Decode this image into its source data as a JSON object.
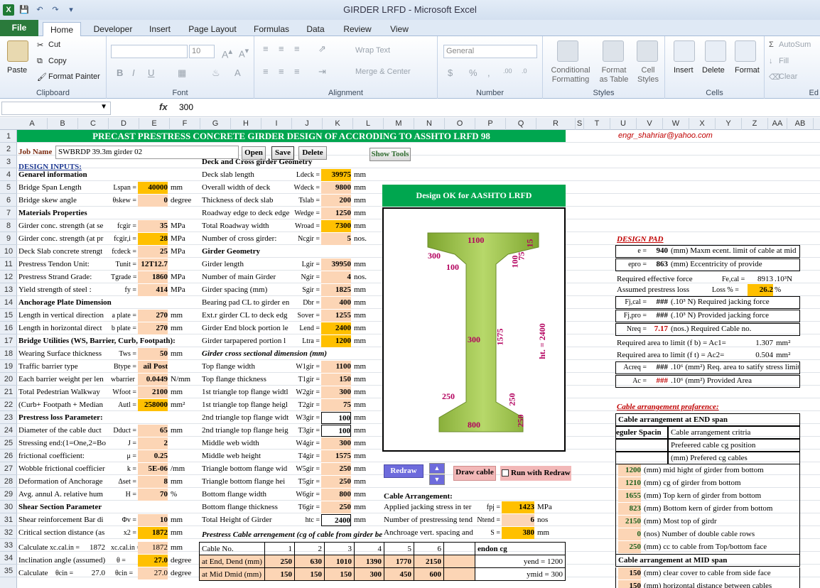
{
  "window": {
    "title": "GIRDER LRFD  -  Microsoft Excel"
  },
  "tabs": [
    "File",
    "Home",
    "Developer",
    "Insert",
    "Page Layout",
    "Formulas",
    "Data",
    "Review",
    "View"
  ],
  "ribbon": {
    "clipboard": {
      "paste": "Paste",
      "cut": "Cut",
      "copy": "Copy",
      "format_painter": "Format Painter",
      "label": "Clipboard"
    },
    "font": {
      "size": "10",
      "label": "Font",
      "bold": "B",
      "italic": "I",
      "underline": "U"
    },
    "alignment": {
      "wrap": "Wrap Text",
      "merge": "Merge & Center",
      "label": "Alignment"
    },
    "number": {
      "format": "General",
      "label": "Number"
    },
    "styles": {
      "conditional": "Conditional Formatting",
      "format_table": "Format as Table",
      "cell_styles": "Cell Styles",
      "label": "Styles"
    },
    "cells": {
      "insert": "Insert",
      "delete": "Delete",
      "format": "Format",
      "label": "Cells"
    },
    "editing": {
      "autosum": "AutoSum",
      "fill": "Fill",
      "clear": "Clear",
      "label": "Ed"
    }
  },
  "formula_bar": {
    "fx": "fx",
    "value": "300"
  },
  "columns": [
    "A",
    "B",
    "C",
    "D",
    "E",
    "F",
    "G",
    "H",
    "I",
    "J",
    "K",
    "L",
    "M",
    "N",
    "O",
    "P",
    "Q",
    "R",
    "S",
    "T",
    "U",
    "V",
    "W",
    "X",
    "Y",
    "Z",
    "AA",
    "AB"
  ],
  "rows": [
    "1",
    "2",
    "3",
    "4",
    "5",
    "6",
    "7",
    "8",
    "9",
    "10",
    "11",
    "12",
    "13",
    "14",
    "15",
    "16",
    "17",
    "18",
    "19",
    "20",
    "21",
    "22",
    "23",
    "24",
    "25",
    "26",
    "27",
    "28",
    "29",
    "30",
    "31",
    "32",
    "33",
    "34",
    "35"
  ],
  "sheet": {
    "banner": "PRECAST PRESTRESS CONCRETE GIRDER DESIGN OF  ACCRODING TO ASSHTO LRFD 98",
    "email": "engr_shahriar@yahoo.com",
    "job_label": "Job Name",
    "job_value": "SWBRDP 39.3m girder 02",
    "btn_open": "Open",
    "btn_save": "Save",
    "btn_delete": "Delete",
    "btn_show_tools": "Show Tools",
    "design_inputs": "DESIGN INPUTS:",
    "left": [
      {
        "r": 4,
        "label": "Genarel information",
        "bold": true
      },
      {
        "r": 5,
        "label": "Bridge Span Length",
        "sym": "Lspan =",
        "val": "40000",
        "unit": "mm",
        "y": true
      },
      {
        "r": 6,
        "label": "Bridge skew angle",
        "sym": "θskew =",
        "val": "0",
        "unit": "degree"
      },
      {
        "r": 7,
        "label": "Materials Properties",
        "bold": true
      },
      {
        "r": 8,
        "label": "Girder conc. strength (at se",
        "sym": "fcgir =",
        "val": "35",
        "unit": "MPa"
      },
      {
        "r": 9,
        "label": "Girder conc. strength (at pr",
        "sym": "fcgir,i =",
        "val": "28",
        "unit": "MPa",
        "y": true
      },
      {
        "r": 10,
        "label": "Deck Slab concrete  strengt",
        "sym": "fcdeck =",
        "val": "25",
        "unit": "MPa"
      },
      {
        "r": 11,
        "label": "Prestress Tendon Unit:",
        "sym": "Tunit =",
        "val": "12T12.7",
        "unit": ""
      },
      {
        "r": 12,
        "label": "Prestress Strand Grade:",
        "sym": "Tgrade =",
        "val": "1860",
        "unit": "MPa"
      },
      {
        "r": 13,
        "label": "Yield strength of steel :",
        "sym": "fy =",
        "val": "414",
        "unit": "MPa"
      },
      {
        "r": 14,
        "label": "Anchorage Plate Dimension",
        "bold": true
      },
      {
        "r": 15,
        "label": "Length in vertical direction",
        "sym": "a plate =",
        "val": "270",
        "unit": "mm"
      },
      {
        "r": 16,
        "label": "Length in horizontal direct",
        "sym": "b plate =",
        "val": "270",
        "unit": "mm"
      },
      {
        "r": 17,
        "label": "Bridge Utilities (WS, Barrier, Curb, Footpath):",
        "bold": true
      },
      {
        "r": 18,
        "label": "Wearing Surface thickness",
        "sym": "Tws =",
        "val": "50",
        "unit": "mm"
      },
      {
        "r": 19,
        "label": "Traffic barrier type",
        "sym": "Btype =",
        "val": "ail Post",
        "unit": ""
      },
      {
        "r": 20,
        "label": "Each barrier weight per len",
        "sym": "wbarrier =",
        "val": "0.0449",
        "unit": "N/mm"
      },
      {
        "r": 21,
        "label": "Total Pedestrian Walkway",
        "sym": "Wfoot =",
        "val": "2100",
        "unit": "mm"
      },
      {
        "r": 22,
        "label": "(Curb+ Footpath + Median",
        "sym": "Autl =",
        "val": "258000",
        "unit": "mm²",
        "y": true
      },
      {
        "r": 23,
        "label": "Prestress loss Parameter:",
        "bold": true
      },
      {
        "r": 24,
        "label": "Diameter of the cable duct",
        "sym": "Dduct =",
        "val": "65",
        "unit": "mm"
      },
      {
        "r": 25,
        "label": "Stressing end:(1=One,2=Bo",
        "sym": "J =",
        "val": "2",
        "unit": ""
      },
      {
        "r": 26,
        "label": "frictional coefficient:",
        "sym": "μ =",
        "val": "0.25",
        "unit": ""
      },
      {
        "r": 27,
        "label": "Wobble frictional coefficier",
        "sym": "k =",
        "val": "5E-06",
        "unit": "/mm"
      },
      {
        "r": 28,
        "label": "Deformation of Anchorage",
        "sym": "Δset =",
        "val": "8",
        "unit": "mm"
      },
      {
        "r": 29,
        "label": "Avg. annul A. relative hum",
        "sym": "H =",
        "val": "70",
        "unit": "%"
      },
      {
        "r": 30,
        "label": "Shear Section Parameter",
        "bold": true
      },
      {
        "r": 31,
        "label": "Shear reinforcement Bar di",
        "sym": "Φv =",
        "val": "10",
        "unit": "mm"
      },
      {
        "r": 32,
        "label": "Critical section distance (as",
        "sym": "x2 =",
        "val": "1872",
        "unit": "mm",
        "y": true
      }
    ],
    "row33": {
      "a": "Calculate",
      "b": "xc.cal.in =",
      "c": "1872",
      "d": "xc.cal.in =",
      "e": "1872",
      "f": "mm"
    },
    "row34": {
      "a": "Inclination angle (assumed)",
      "sym": "θ =",
      "val": "27.0",
      "unit": "degree"
    },
    "row35": {
      "a": "Calculate",
      "b": "θcin =",
      "c": "27.0",
      "d": "θcin =",
      "e": "27.0",
      "f": "degree"
    },
    "mid": [
      {
        "r": 3,
        "label": "Deck and Cross girder Geometry",
        "bold": true
      },
      {
        "r": 4,
        "label": "Deck slab length",
        "sym": "Ldeck =",
        "val": "39975",
        "unit": "mm",
        "y": true
      },
      {
        "r": 5,
        "label": "Overall width of deck",
        "sym": "Wdeck =",
        "val": "9800",
        "unit": "mm"
      },
      {
        "r": 6,
        "label": "Thickness of deck slab",
        "sym": "Tslab =",
        "val": "200",
        "unit": "mm"
      },
      {
        "r": 7,
        "label": "Roadway edge to deck edge",
        "sym": "Wedge =",
        "val": "1250",
        "unit": "mm"
      },
      {
        "r": 8,
        "label": "Total Roadway width",
        "sym": "Wroad =",
        "val": "7300",
        "unit": "mm",
        "y": true
      },
      {
        "r": 9,
        "label": "Number of cross girder:",
        "sym": "Ncgir =",
        "val": "5",
        "unit": "nos."
      },
      {
        "r": 10,
        "label": "Girder Geometry",
        "bold": true
      },
      {
        "r": 11,
        "label": "Girder length",
        "sym": "Lgir =",
        "val": "39950",
        "unit": "mm"
      },
      {
        "r": 12,
        "label": "Number of main Girder",
        "sym": "Ngir =",
        "val": "4",
        "unit": "nos."
      },
      {
        "r": 13,
        "label": "Girder spacing (mm)",
        "sym": "Sgir =",
        "val": "1825",
        "unit": "mm"
      },
      {
        "r": 14,
        "label": "Bearing pad CL to girder en",
        "sym": "Dbr =",
        "val": "400",
        "unit": "mm"
      },
      {
        "r": 15,
        "label": "Ext.r girder CL to deck edg",
        "sym": "Sover =",
        "val": "1255",
        "unit": "mm"
      },
      {
        "r": 16,
        "label": "Girder End block portion le",
        "sym": "Lend =",
        "val": "2400",
        "unit": "mm",
        "y": true
      },
      {
        "r": 17,
        "label": "Girder tarpapered portion l",
        "sym": "Ltra =",
        "val": "1200",
        "unit": "mm",
        "y": true
      },
      {
        "r": 18,
        "label": "Girder cross sectional dimension (mm)",
        "bold": true,
        "italic": true
      },
      {
        "r": 19,
        "label": "Top flange width",
        "sym": "W1gir =",
        "val": "1100",
        "unit": "mm"
      },
      {
        "r": 20,
        "label": "Top flange thickness",
        "sym": "T1gir =",
        "val": "150",
        "unit": "mm"
      },
      {
        "r": 21,
        "label": "1st triangle top flange widtl",
        "sym": "W2gir =",
        "val": "300",
        "unit": "mm"
      },
      {
        "r": 22,
        "label": "1st triangle top flange heigl",
        "sym": "T2gir =",
        "val": "75",
        "unit": "mm"
      },
      {
        "r": 23,
        "label": "2nd triangle top flange widt",
        "sym": "W3gir =",
        "val": "100",
        "unit": "mm",
        "w": true
      },
      {
        "r": 24,
        "label": "2nd triangle top flange heig",
        "sym": "T3gir =",
        "val": "100",
        "unit": "mm",
        "w": true
      },
      {
        "r": 25,
        "label": "Middle web width",
        "sym": "W4gir =",
        "val": "300",
        "unit": "mm"
      },
      {
        "r": 26,
        "label": "Middle web height",
        "sym": "T4gir =",
        "val": "1575",
        "unit": "mm"
      },
      {
        "r": 27,
        "label": "Triangle bottom flange wid",
        "sym": "W5gir =",
        "val": "250",
        "unit": "mm"
      },
      {
        "r": 28,
        "label": "Triangle bottom flange hei",
        "sym": "T5gir =",
        "val": "250",
        "unit": "mm"
      },
      {
        "r": 29,
        "label": "Bottom flange width",
        "sym": "W6gir =",
        "val": "800",
        "unit": "mm"
      },
      {
        "r": 30,
        "label": "Bottom flange thickness",
        "sym": "T6gir =",
        "val": "250",
        "unit": "mm"
      },
      {
        "r": 31,
        "label": "Total Height of Girder",
        "sym": "htc =",
        "val": "2400",
        "unit": "mm",
        "w": true
      }
    ],
    "mid32": "Prestress Cable arrengement (cg of cable from girder be",
    "design_ok": "Design OK for AASHTO LRFD",
    "dims": {
      "top": "1100",
      "d300a": "300",
      "d100a": "100",
      "d15": "15",
      "d75": "75",
      "d100b": "100",
      "web": "300",
      "h1575": "1575",
      "ht": "ht. = 2400",
      "d250a": "250",
      "d250b": "250",
      "d250c": "250",
      "bot": "800"
    },
    "redraw": "Redraw",
    "draw_cable": "Draw cable",
    "run_redraw": "Run with Redraw",
    "cable_arr": "Cable Arrangement:",
    "cable_rows": [
      {
        "label": "Applied jacking stress in ter",
        "sym": "fpj =",
        "val": "1423",
        "unit": "MPa",
        "y": true
      },
      {
        "label": "Number of prestressing tend",
        "sym": "Ntend =",
        "val": "6",
        "unit": "nos"
      },
      {
        "label": "Anchroage vert. spacing and",
        "sym": "S =",
        "val": "380",
        "unit": "mm",
        "y": true
      }
    ],
    "cable_table": {
      "head": [
        "Cable No.",
        "1",
        "2",
        "3",
        "4",
        "5",
        "6"
      ],
      "end": [
        "at End, Dend (mm)",
        "250",
        "630",
        "1010",
        "1390",
        "1770",
        "2150"
      ],
      "mid": [
        "at Mid Dmid (mm)",
        "150",
        "150",
        "150",
        "300",
        "450",
        "600"
      ],
      "tendon_cg": "endon cg",
      "yend": "yend = 1200",
      "ymid": "ymid = 300"
    },
    "design_pad": {
      "title": "DESIGN PAD",
      "e": {
        "sym": "e =",
        "val": "940",
        "text": "(mm) Maxm ecent. limit of cable at mid"
      },
      "epro": {
        "sym": "epro =",
        "val": "863",
        "text": "(mm) Eccentricity of provide"
      },
      "feff": {
        "text": "Required effective force",
        "sym": "Fe,cal =",
        "val": "8913",
        "unit": ".10³N"
      },
      "loss": {
        "text": "Assumed prestress loss",
        "sym": "Loss % =",
        "val": "26.2",
        "unit": "%"
      },
      "fjcal": {
        "sym": "Fj,cal =",
        "val": "###",
        "text": "(.10³ N) Required jacking force"
      },
      "fjpro": {
        "sym": "Fj,pro =",
        "val": "###",
        "text": "(.10³ N) Provided jacking force"
      },
      "nreq": {
        "sym": "Nreq =",
        "val": "7.17",
        "text": "(nos.) Required Cable no."
      },
      "ac1": {
        "text": "Required area to limit (f b) = Ac1=",
        "val": "1.307",
        "unit": "mm²"
      },
      "ac2": {
        "text": "Required area to limit (f t) = Ac2=",
        "val": "0.504",
        "unit": "mm²"
      },
      "acreq": {
        "sym": "Acreq =",
        "val": "###",
        "text": ".10⁶ (mm²) Req. area to satify stress limit"
      },
      "ac": {
        "sym": "Ac =",
        "val": "###",
        "text": ".10⁶ (mm²) Provided Area"
      }
    },
    "cable_pref": {
      "title": "Cable arrangement prafarence:",
      "end_span": "Cable arrangement at END span",
      "reg": "eguler Spacin",
      "crit": "Cable arrangement critria",
      "pref_cg": "Prefeered cable cg position",
      "pref_cables": "(mm) Prefered cg cables",
      "rows": [
        {
          "val": "1200",
          "text": "(mm) mid hight of girder from bottom"
        },
        {
          "val": "1210",
          "text": "(mm) cg of girder from bottom"
        },
        {
          "val": "1655",
          "text": "(mm) Top kern of girder from bottom"
        },
        {
          "val": "823",
          "text": "(mm) Bottom kern of girder from bottom"
        },
        {
          "val": "2150",
          "text": "(mm) Most top of girdr"
        },
        {
          "val": "0",
          "text": "(nos) Number of double cable rows"
        },
        {
          "val": "250",
          "text": "(mm) cc to cable from Top/bottom face"
        }
      ],
      "mid_span": "Cable arrangement at MID span",
      "rows2": [
        {
          "val": "150",
          "text": "(mm) clear cover to cable from side face"
        },
        {
          "val": "150",
          "text": "(mm) horizontal distance between cables"
        }
      ]
    }
  }
}
